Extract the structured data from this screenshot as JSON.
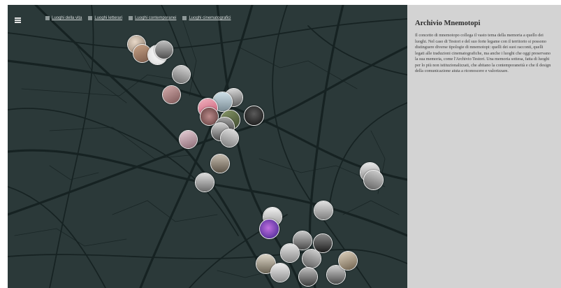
{
  "filters": [
    {
      "label": "Luoghi della vita",
      "color": "#8f9999"
    },
    {
      "label": "Luoghi letterari",
      "color": "#8f9999"
    },
    {
      "label": "Luoghi contemporanei",
      "color": "#8f9999"
    },
    {
      "label": "Luoghi cinematografici",
      "color": "#8f9999"
    }
  ],
  "panel": {
    "title": "Archivio Mnemotopi",
    "body": "Il concetto di mnemotopo collega il vasto tema della memoria a quello dei luoghi. Nel caso di Testori e del suo forte legame con il territorio si possono distinguere diverse tipologie di mnemotopi: quelli dei suoi racconti, quelli legati alle traduzioni cinematografiche, ma anche i luoghi che oggi preservano la sua memoria, come l'Archivio Testori. Una memoria sottesa, fatta di luoghi per lo più non istituzionalizzati, che abitano la contemporaneità e che il design della comunicazione aiuta a riconoscere e valorizzare."
  },
  "colors": {
    "map_background": "#2b3939",
    "road": "#162222",
    "panel_background": "#d3d3d3",
    "pin_border": "#f2f2f2"
  }
}
